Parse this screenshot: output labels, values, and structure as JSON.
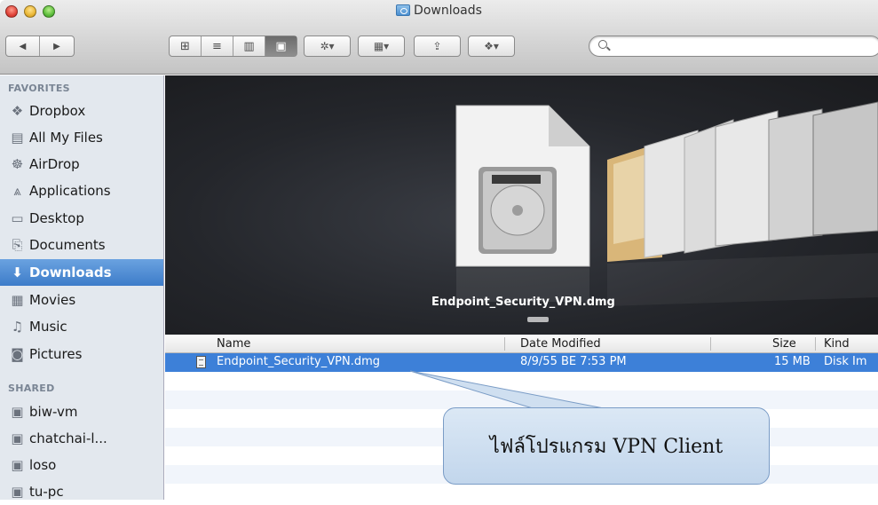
{
  "window": {
    "title": "Downloads"
  },
  "toolbar": {
    "back": "◀",
    "forward": "▶",
    "view_icons": "⊞",
    "view_list": "≡",
    "view_columns": "▥",
    "view_coverflow": "▣",
    "action_label": "✲▾",
    "arrange_label": "▦▾",
    "share_label": "⇪",
    "dropbox_label": "❖▾"
  },
  "sidebar": {
    "favorites_header": "FAVORITES",
    "favorites": [
      {
        "label": "Dropbox",
        "icon": "dropbox-icon"
      },
      {
        "label": "All My Files",
        "icon": "all-files-icon"
      },
      {
        "label": "AirDrop",
        "icon": "airdrop-icon"
      },
      {
        "label": "Applications",
        "icon": "applications-icon"
      },
      {
        "label": "Desktop",
        "icon": "desktop-icon"
      },
      {
        "label": "Documents",
        "icon": "documents-icon"
      },
      {
        "label": "Downloads",
        "icon": "downloads-icon"
      },
      {
        "label": "Movies",
        "icon": "movies-icon"
      },
      {
        "label": "Music",
        "icon": "music-icon"
      },
      {
        "label": "Pictures",
        "icon": "pictures-icon"
      }
    ],
    "shared_header": "SHARED",
    "shared": [
      {
        "label": "biw-vm"
      },
      {
        "label": "chatchai-l..."
      },
      {
        "label": "loso"
      },
      {
        "label": "tu-pc"
      }
    ]
  },
  "preview": {
    "selected_file_label": "Endpoint_Security_VPN.dmg"
  },
  "list": {
    "columns": {
      "name": "Name",
      "date": "Date Modified",
      "size": "Size",
      "kind": "Kind"
    },
    "rows": [
      {
        "name": "Endpoint_Security_VPN.dmg",
        "date": "8/9/55 BE 7:53 PM",
        "size": "15 MB",
        "kind": "Disk Im"
      }
    ]
  },
  "callout": {
    "text": "ไฟล์โปรแกรม VPN Client"
  },
  "colors": {
    "selection": "#3d80d8",
    "sidebar_bg": "#e3e8ee",
    "callout_bg": "#c9dbef"
  }
}
